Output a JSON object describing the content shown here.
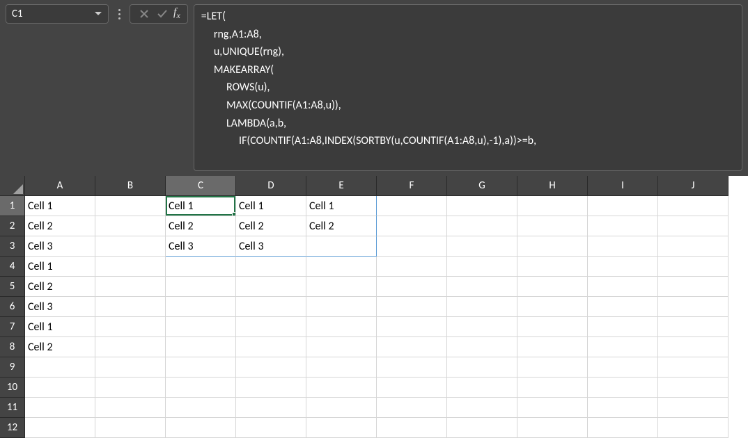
{
  "name_box": {
    "value": "C1"
  },
  "formula": {
    "text": "=LET(\n     rng,A1:A8,\n     u,UNIQUE(rng),\n     MAKEARRAY(\n          ROWS(u),\n          MAX(COUNTIF(A1:A8,u)),\n          LAMBDA(a,b,\n               IF(COUNTIF(A1:A8,INDEX(SORTBY(u,COUNTIF(A1:A8,u),-1),a))>=b,"
  },
  "columns": [
    "A",
    "B",
    "C",
    "D",
    "E",
    "F",
    "G",
    "H",
    "I",
    "J"
  ],
  "rows": [
    "1",
    "2",
    "3",
    "4",
    "5",
    "6",
    "7",
    "8",
    "9",
    "10",
    "11",
    "12"
  ],
  "active_cell": "C1",
  "selected_column": "C",
  "selected_row": "1",
  "spill_range": {
    "start": "C1",
    "end": "E3"
  },
  "cells": {
    "A1": "Cell 1",
    "A2": "Cell 2",
    "A3": "Cell 3",
    "A4": "Cell 1",
    "A5": "Cell 2",
    "A6": "Cell 3",
    "A7": "Cell 1",
    "A8": "Cell 2",
    "C1": "Cell 1",
    "C2": "Cell 2",
    "C3": "Cell 3",
    "D1": "Cell 1",
    "D2": "Cell 2",
    "D3": "Cell 3",
    "E1": "Cell 1",
    "E2": "Cell 2"
  }
}
